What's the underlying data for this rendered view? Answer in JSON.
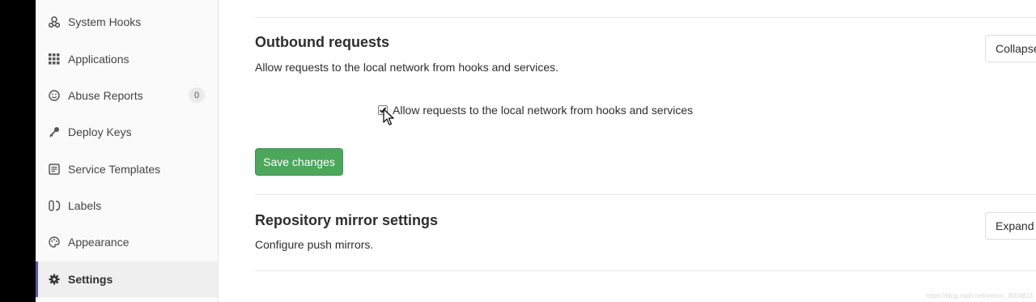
{
  "sidebar": {
    "items": [
      {
        "label": "System Hooks",
        "icon": "hook-icon"
      },
      {
        "label": "Applications",
        "icon": "grid-icon"
      },
      {
        "label": "Abuse Reports",
        "icon": "smiley-icon",
        "badge": "0"
      },
      {
        "label": "Deploy Keys",
        "icon": "key-icon"
      },
      {
        "label": "Service Templates",
        "icon": "template-icon"
      },
      {
        "label": "Labels",
        "icon": "labels-icon"
      },
      {
        "label": "Appearance",
        "icon": "palette-icon"
      },
      {
        "label": "Settings",
        "icon": "gear-icon",
        "active": true
      }
    ]
  },
  "outbound": {
    "title": "Outbound requests",
    "description": "Allow requests to the local network from hooks and services.",
    "collapse_label": "Collapse",
    "checkbox_label": "Allow requests to the local network from hooks and services",
    "checkbox_checked": true,
    "save_label": "Save changes"
  },
  "mirror": {
    "title": "Repository mirror settings",
    "description": "Configure push mirrors.",
    "expand_label": "Expand"
  },
  "watermark": "https://blog.csdn.net/weixin_3004813"
}
